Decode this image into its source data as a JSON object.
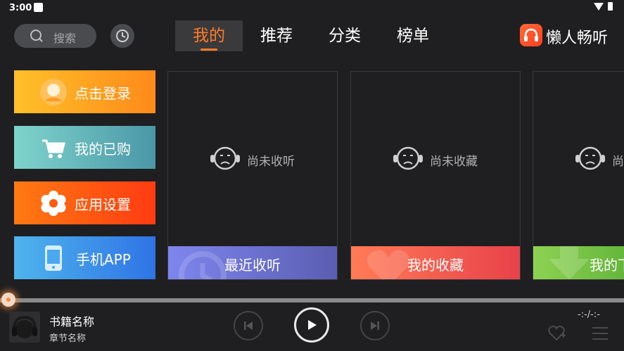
{
  "status_bar": {
    "time": "3:00"
  },
  "header": {
    "search_placeholder": "搜索",
    "tabs": [
      {
        "label": "我的",
        "active": true
      },
      {
        "label": "推荐",
        "active": false
      },
      {
        "label": "分类",
        "active": false
      },
      {
        "label": "榜单",
        "active": false
      }
    ],
    "brand_name": "懒人畅听"
  },
  "side_buttons": [
    {
      "label": "点击登录",
      "icon": "user-avatar-icon"
    },
    {
      "label": "我的已购",
      "icon": "cart-icon"
    },
    {
      "label": "应用设置",
      "icon": "gear-icon"
    },
    {
      "label": "手机APP",
      "icon": "phone-app-icon"
    }
  ],
  "cards": [
    {
      "empty_text": "尚未收听",
      "footer_label": "最近收听",
      "color": "#6f74d6"
    },
    {
      "empty_text": "尚未收藏",
      "footer_label": "我的收藏",
      "color": "#f25a4c"
    },
    {
      "empty_text": "尚",
      "footer_label": "我的下",
      "color": "#7cc847"
    }
  ],
  "player": {
    "book_name": "书籍名称",
    "chapter_name": "章节名称",
    "time": "-:-/-:-",
    "progress": 0
  },
  "colors": {
    "accent": "#ff7b27",
    "background": "#1f1f21"
  }
}
